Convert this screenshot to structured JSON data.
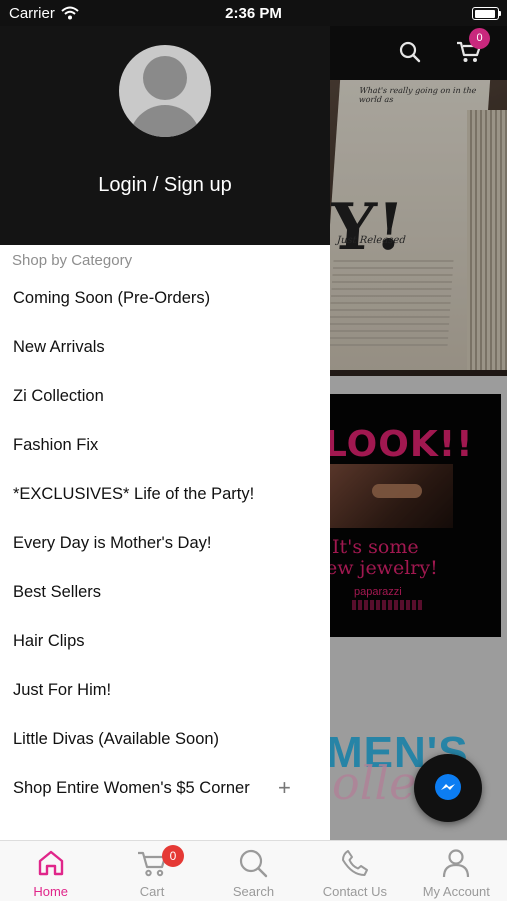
{
  "status_bar": {
    "carrier": "Carrier",
    "time": "2:36 PM"
  },
  "header": {
    "cart_count": "0"
  },
  "drawer": {
    "login_label": "Login / Sign up",
    "section_title": "Shop by Category",
    "items": [
      {
        "label": "Coming Soon (Pre-Orders)"
      },
      {
        "label": "New Arrivals"
      },
      {
        "label": "Zi Collection"
      },
      {
        "label": "Fashion Fix"
      },
      {
        "label": "*EXCLUSIVES* Life of the Party!"
      },
      {
        "label": "Every Day is Mother's Day!"
      },
      {
        "label": "Best Sellers"
      },
      {
        "label": "Hair Clips"
      },
      {
        "label": "Just For Him!"
      },
      {
        "label": "Little Divas (Available Soon)"
      },
      {
        "label": "Shop Entire Women's $5 Corner",
        "expand": "+"
      }
    ]
  },
  "background": {
    "hero_headline": "Y!",
    "hero_subtitle": "Just Released",
    "hero_header": "What's really going on in the world as",
    "promo_line1": "LOOK!!",
    "promo_line2": "It's some",
    "promo_line3": "ew jewelry!",
    "promo_brand": "paparazzi",
    "womens": "MEN'S",
    "womens_script": "ollect"
  },
  "tabbar": {
    "cart_badge": "0",
    "tabs": [
      {
        "label": "Home",
        "icon": "home-icon",
        "active": true
      },
      {
        "label": "Cart",
        "icon": "cart-icon"
      },
      {
        "label": "Search",
        "icon": "search-icon"
      },
      {
        "label": "Contact Us",
        "icon": "phone-icon"
      },
      {
        "label": "My Account",
        "icon": "account-icon"
      }
    ]
  },
  "colors": {
    "accent": "#e0268a",
    "drawer_header": "#141414",
    "badge": "#e53935"
  }
}
